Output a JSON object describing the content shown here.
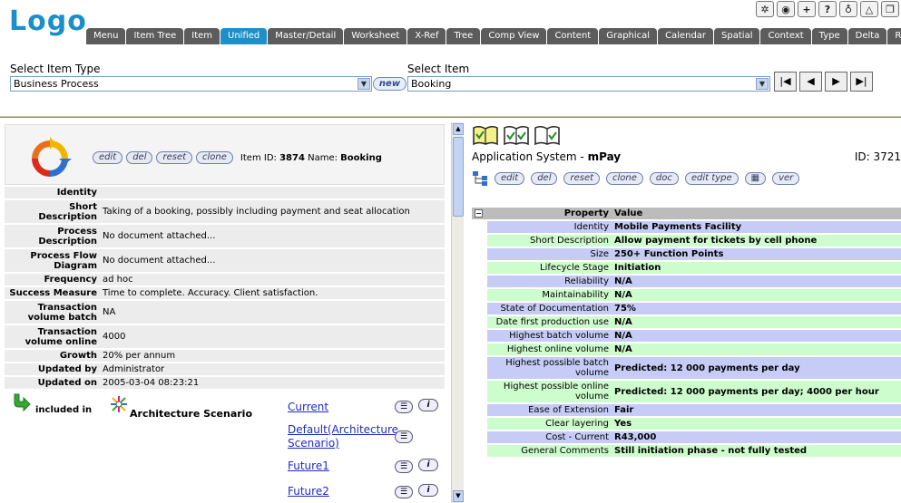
{
  "header": {
    "logo": "Logo",
    "top_icons": [
      {
        "icon": "ship-wheel-icon",
        "glyph": "✲"
      },
      {
        "icon": "globe-color-icon",
        "glyph": "◉"
      },
      {
        "icon": "plus-icon",
        "glyph": "+"
      },
      {
        "icon": "help-icon",
        "glyph": "?"
      },
      {
        "icon": "pin-icon",
        "glyph": "♁"
      },
      {
        "icon": "triangle-icon",
        "glyph": "△"
      },
      {
        "icon": "copy-icon",
        "glyph": "❐"
      }
    ],
    "tabs": [
      "Menu",
      "Item Tree",
      "Item",
      "Unified",
      "Master/Detail",
      "Worksheet",
      "X-Ref",
      "Tree",
      "Comp View",
      "Content",
      "Graphical",
      "Calendar",
      "Spatial",
      "Context",
      "Type",
      "Delta",
      "Repo"
    ],
    "active_tab": "Unified"
  },
  "selectors": {
    "item_type_label": "Select Item Type",
    "item_type_value": "Business Process",
    "new_label": "new",
    "item_label": "Select Item",
    "item_value": "Booking"
  },
  "left": {
    "buttons": [
      "edit",
      "del",
      "reset",
      "clone"
    ],
    "item_id_label": "Item ID:",
    "item_id": "3874",
    "name_label": "Name:",
    "name": "Booking",
    "properties": [
      {
        "key": "Identity",
        "value": ""
      },
      {
        "key": "Short Description",
        "value": "Taking of a booking, possibly including payment and seat allocation"
      },
      {
        "key": "Process Description",
        "value": "No document attached..."
      },
      {
        "key": "Process Flow Diagram",
        "value": "No document attached..."
      },
      {
        "key": "Frequency",
        "value": "ad hoc"
      },
      {
        "key": "Success Measure",
        "value": "Time to complete. Accuracy. Client satisfaction."
      },
      {
        "key": "Transaction volume batch",
        "value": "NA"
      },
      {
        "key": "Transaction volume online",
        "value": "4000"
      },
      {
        "key": "Growth",
        "value": "20% per annum"
      },
      {
        "key": "Updated by",
        "value": "Administrator"
      },
      {
        "key": "Updated on",
        "value": "2005-03-04 08:23:21"
      }
    ],
    "included_in_label": "included in",
    "architecture_label": "Architecture Scenario",
    "relations": [
      "Current",
      "Default(Architecture Scenario)",
      "Future1",
      "Future2"
    ]
  },
  "right": {
    "app_type": "Application System -",
    "app_name": "mPay",
    "id_label": "ID: 3721",
    "buttons": [
      "edit",
      "del",
      "reset",
      "clone",
      "doc",
      "edit type",
      "▦",
      "ver"
    ],
    "header": {
      "key": "Property",
      "value": "Value"
    },
    "properties": [
      {
        "key": "Identity",
        "value": "Mobile Payments Facility"
      },
      {
        "key": "Short Description",
        "value": "Allow payment for tickets by cell phone"
      },
      {
        "key": "Size",
        "value": "250+ Function Points"
      },
      {
        "key": "Lifecycle Stage",
        "value": "Initiation"
      },
      {
        "key": "Reliability",
        "value": "N/A"
      },
      {
        "key": "Maintainability",
        "value": "N/A"
      },
      {
        "key": "State of Documentation",
        "value": "75%"
      },
      {
        "key": "Date first production use",
        "value": "N/A"
      },
      {
        "key": "Highest batch volume",
        "value": "N/A"
      },
      {
        "key": "Highest online volume",
        "value": "N/A"
      },
      {
        "key": "Highest possible batch volume",
        "value": "Predicted: 12 000 payments per day"
      },
      {
        "key": "Highest possible online volume",
        "value": "Predicted: 12 000 payments per day; 4000 per hour"
      },
      {
        "key": "Ease of Extension",
        "value": "Fair"
      },
      {
        "key": "Clear layering",
        "value": "Yes"
      },
      {
        "key": "Cost - Current",
        "value": "R43,000"
      },
      {
        "key": "General Comments",
        "value": "Still initiation phase - not fully tested"
      }
    ]
  },
  "colors": {
    "logo": "#1a8fc9",
    "tab": "#5c5c5c",
    "tab_active": "#1f8fc8",
    "row_blue": "#c6ccf6",
    "row_green": "#cdfccd",
    "link": "#1f2bbf"
  }
}
